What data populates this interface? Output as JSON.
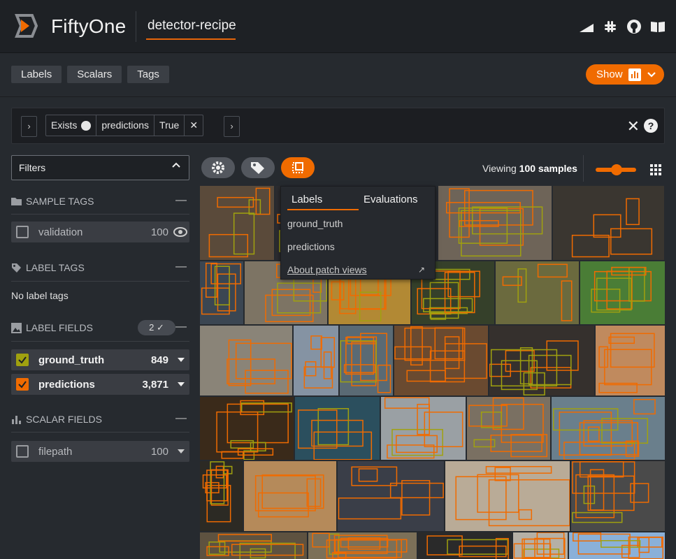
{
  "app": {
    "brand": "FiftyOne",
    "dataset": "detector-recipe"
  },
  "header_icons": [
    "signal-icon",
    "slack-icon",
    "github-icon",
    "docs-icon"
  ],
  "tabs": [
    {
      "label": "Labels"
    },
    {
      "label": "Scalars"
    },
    {
      "label": "Tags"
    }
  ],
  "show_button": {
    "label": "Show"
  },
  "view_bar": {
    "stage": {
      "op": "Exists",
      "field": "predictions",
      "value": "True"
    },
    "close_glyph": "✕",
    "help_glyph": "?"
  },
  "sidebar": {
    "filters_label": "Filters",
    "sample_tags": {
      "title": "SAMPLE TAGS",
      "items": [
        {
          "label": "validation",
          "count": "100"
        }
      ]
    },
    "label_tags": {
      "title": "LABEL TAGS",
      "empty": "No label tags"
    },
    "label_fields": {
      "title": "LABEL FIELDS",
      "badge": "2 ✓",
      "items": [
        {
          "label": "ground_truth",
          "count": "849",
          "color": "#a0a10f"
        },
        {
          "label": "predictions",
          "count": "3,871",
          "color": "#f06b00"
        }
      ]
    },
    "scalar_fields": {
      "title": "SCALAR FIELDS",
      "items": [
        {
          "label": "filepath",
          "count": "100"
        }
      ]
    }
  },
  "grid_bar": {
    "viewing_prefix": "Viewing",
    "viewing_count": "100 samples"
  },
  "popover": {
    "tabs": [
      "Labels",
      "Evaluations"
    ],
    "items": [
      "ground_truth",
      "predictions"
    ],
    "link": "About patch views"
  },
  "colors": {
    "accent": "#f06b00",
    "ground_truth": "#a0a10f",
    "predictions": "#f06b00"
  }
}
